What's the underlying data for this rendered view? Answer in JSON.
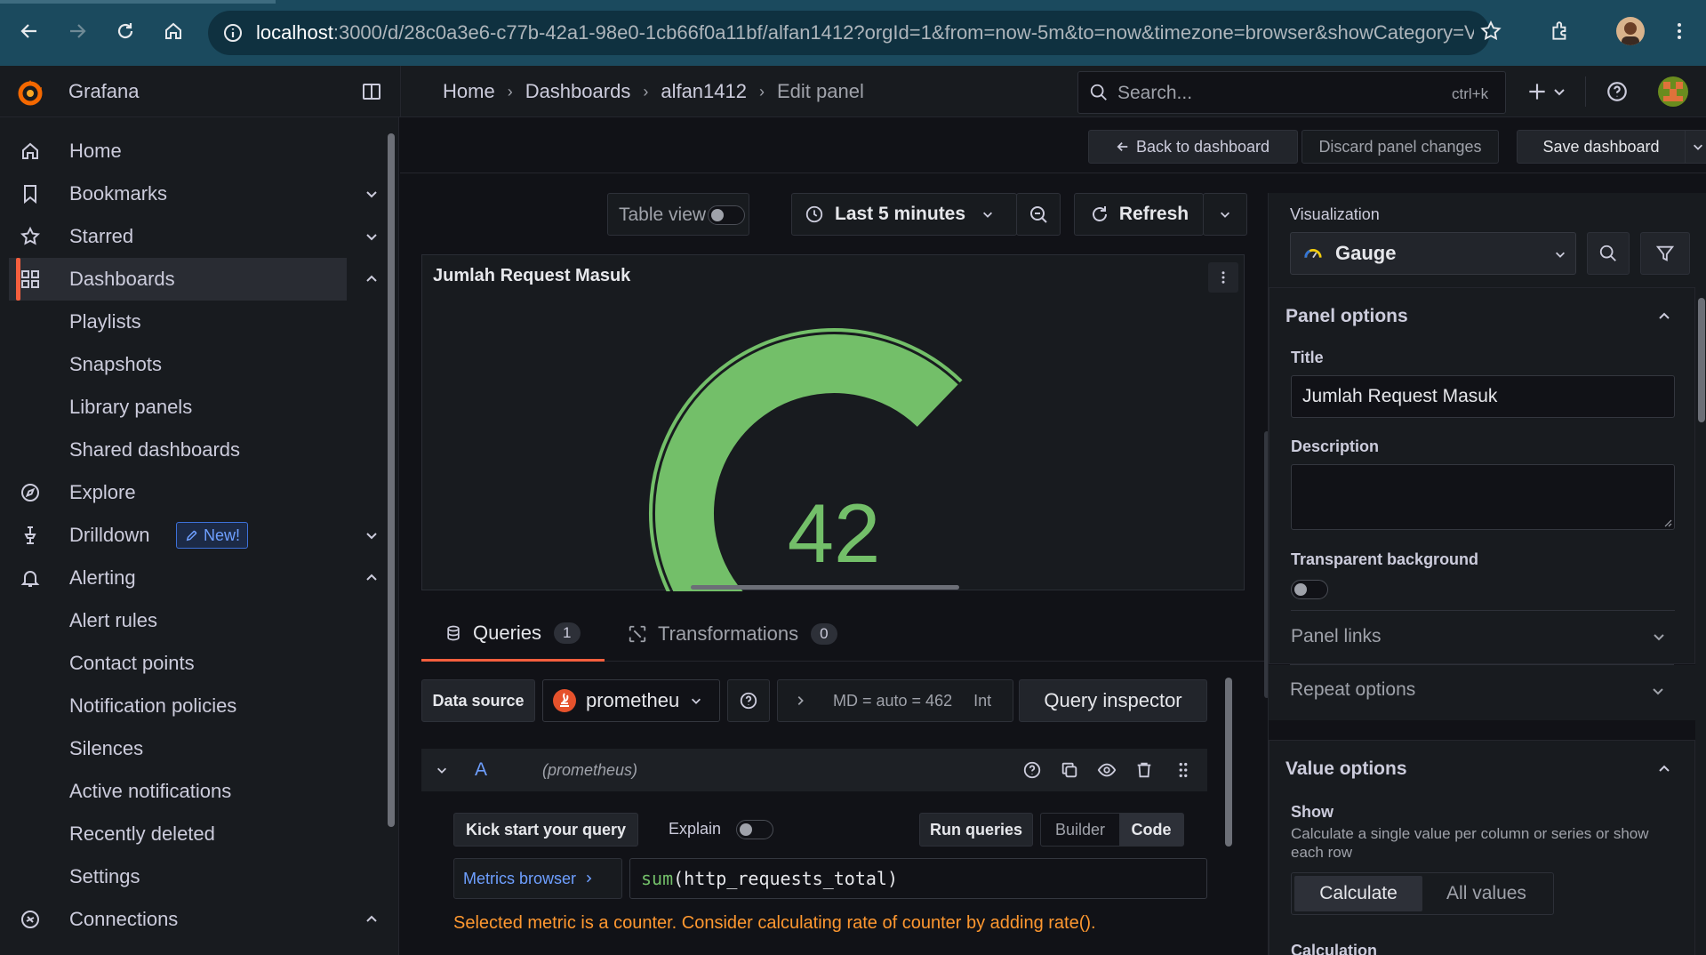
{
  "browser": {
    "url_host": "localhost",
    "url_rest": ":3000/d/28c0a3e6-c77b-42a1-98e0-1cb66f0a11bf/alfan1412?orgId=1&from=now-5m&to=now&timezone=browser&showCategory=V..."
  },
  "topbar": {
    "app_name": "Grafana",
    "breadcrumb": [
      "Home",
      "Dashboards",
      "alfan1412",
      "Edit panel"
    ],
    "search_placeholder": "Search...",
    "search_shortcut": "ctrl+k"
  },
  "sidebar": {
    "items": [
      {
        "label": "Home",
        "icon": "home-icon"
      },
      {
        "label": "Bookmarks",
        "icon": "bookmark-icon"
      },
      {
        "label": "Starred",
        "icon": "star-icon"
      },
      {
        "label": "Dashboards",
        "icon": "apps-icon"
      },
      {
        "label": "Playlists"
      },
      {
        "label": "Snapshots"
      },
      {
        "label": "Library panels"
      },
      {
        "label": "Shared dashboards"
      },
      {
        "label": "Explore",
        "icon": "compass-icon"
      },
      {
        "label": "Drilldown",
        "icon": "drilldown-icon",
        "badge": "New!"
      },
      {
        "label": "Alerting",
        "icon": "bell-icon"
      },
      {
        "label": "Alert rules"
      },
      {
        "label": "Contact points"
      },
      {
        "label": "Notification policies"
      },
      {
        "label": "Silences"
      },
      {
        "label": "Active notifications"
      },
      {
        "label": "Recently deleted"
      },
      {
        "label": "Settings"
      },
      {
        "label": "Connections",
        "icon": "connections-icon"
      }
    ]
  },
  "toolbar": {
    "back": "Back to dashboard",
    "discard": "Discard panel changes",
    "save": "Save dashboard"
  },
  "panel_toolbar": {
    "table_view": "Table view",
    "time_range": "Last 5 minutes",
    "refresh": "Refresh"
  },
  "panel": {
    "title": "Jumlah Request Masuk",
    "value": "42",
    "gauge_fraction": 1.0,
    "gauge_color": "#73bf69"
  },
  "tabs": {
    "queries": "Queries",
    "queries_count": "1",
    "transformations": "Transformations",
    "transformations_count": "0"
  },
  "query": {
    "data_source_label": "Data source",
    "data_source": "prometheu",
    "options_text": "MD = auto = 462",
    "options_trunc": "Int",
    "inspector": "Query inspector",
    "ref": "A",
    "ds_hint": "(prometheus)",
    "kick_start": "Kick start your query",
    "explain": "Explain",
    "run": "Run queries",
    "builder": "Builder",
    "code": "Code",
    "metrics_browser": "Metrics browser",
    "expr_fn": "sum",
    "expr_rest": "(http_requests_total)",
    "warning": "Selected metric is a counter. Consider calculating rate of counter by adding rate()."
  },
  "options": {
    "visualization_label": "Visualization",
    "visualization": "Gauge",
    "panel_options": "Panel options",
    "title_label": "Title",
    "title_value": "Jumlah Request Masuk",
    "description_label": "Description",
    "transparent_label": "Transparent background",
    "panel_links": "Panel links",
    "repeat_options": "Repeat options",
    "value_options": "Value options",
    "show_label": "Show",
    "show_desc": "Calculate a single value per column or series or show each row",
    "calculate": "Calculate",
    "all_values": "All values",
    "calculation_partial": "Calculation"
  }
}
